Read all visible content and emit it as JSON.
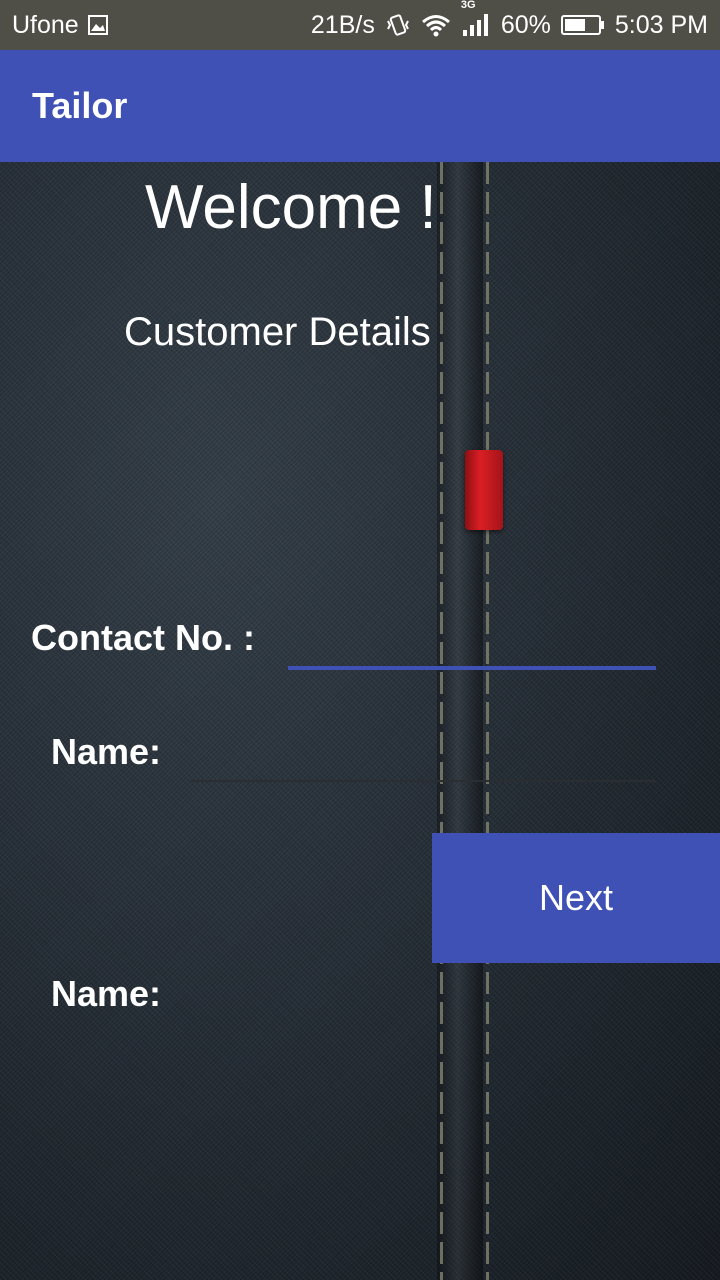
{
  "status_bar": {
    "carrier": "Ufone",
    "net_speed": "21B/s",
    "network_type": "3G",
    "battery_percent": "60%",
    "time": "5:03 PM",
    "icons": [
      "image-icon",
      "vibrate-icon",
      "wifi-icon",
      "signal-icon",
      "battery-icon"
    ]
  },
  "app_bar": {
    "title": "Tailor"
  },
  "main": {
    "welcome": "Welcome !",
    "subtitle": "Customer Details",
    "contact_label": "Contact No. :",
    "contact_value": "",
    "name_label": "Name:",
    "name_value": "",
    "next_label": "Next",
    "name_label_2": "Name:"
  },
  "colors": {
    "primary": "#3f51b5",
    "status_bar": "#4f4f47",
    "text": "#ffffff",
    "tag_red": "#d91f24"
  }
}
